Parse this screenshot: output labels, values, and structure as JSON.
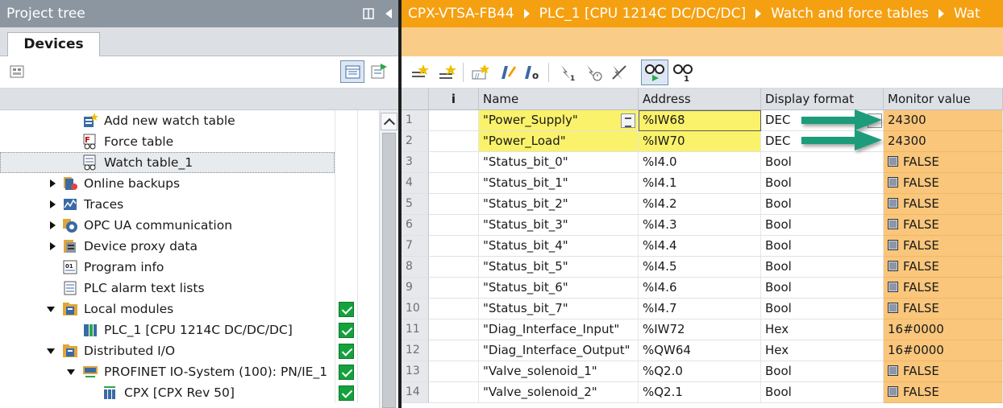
{
  "left_panel": {
    "title": "Project tree",
    "tab_label": "Devices",
    "tree_items": [
      {
        "label": "Add new watch table",
        "icon": "add-watch-table-icon",
        "level": 2,
        "arrow": "none",
        "check": false,
        "selected": false
      },
      {
        "label": "Force table",
        "icon": "force-table-icon",
        "level": 2,
        "arrow": "none",
        "check": false,
        "selected": false
      },
      {
        "label": "Watch table_1",
        "icon": "watch-table-icon",
        "level": 2,
        "arrow": "none",
        "check": false,
        "selected": true
      },
      {
        "label": "Online backups",
        "icon": "online-backups-icon",
        "level": 1,
        "arrow": "right",
        "check": false,
        "selected": false
      },
      {
        "label": "Traces",
        "icon": "traces-icon",
        "level": 1,
        "arrow": "right",
        "check": false,
        "selected": false
      },
      {
        "label": "OPC UA communication",
        "icon": "opc-ua-icon",
        "level": 1,
        "arrow": "right",
        "check": false,
        "selected": false
      },
      {
        "label": "Device proxy data",
        "icon": "device-proxy-icon",
        "level": 1,
        "arrow": "right",
        "check": false,
        "selected": false
      },
      {
        "label": "Program info",
        "icon": "program-info-icon",
        "level": 1,
        "arrow": "none",
        "check": false,
        "selected": false
      },
      {
        "label": "PLC alarm text lists",
        "icon": "alarm-text-icon",
        "level": 1,
        "arrow": "none",
        "check": false,
        "selected": false
      },
      {
        "label": "Local modules",
        "icon": "folder-icon",
        "level": 1,
        "arrow": "down",
        "check": true,
        "selected": false
      },
      {
        "label": "PLC_1 [CPU 1214C DC/DC/DC]",
        "icon": "plc-module-icon",
        "level": 2,
        "arrow": "none",
        "check": true,
        "selected": false
      },
      {
        "label": "Distributed I/O",
        "icon": "folder-icon",
        "level": 1,
        "arrow": "down",
        "check": true,
        "selected": false
      },
      {
        "label": "PROFINET IO-System (100): PN/IE_1",
        "icon": "profinet-system-icon",
        "level": 2,
        "arrow": "down",
        "check": true,
        "selected": false
      },
      {
        "label": "CPX [CPX Rev 50]",
        "icon": "cpx-device-icon",
        "level": 3,
        "arrow": "none",
        "check": true,
        "selected": false
      }
    ]
  },
  "breadcrumb": {
    "items": [
      "CPX-VTSA-FB44",
      "PLC_1 [CPU 1214C DC/DC/DC]",
      "Watch and force tables",
      "Wat"
    ]
  },
  "watch_table": {
    "columns": {
      "info": "i",
      "name": "Name",
      "address": "Address",
      "format": "Display format",
      "monitor": "Monitor value"
    },
    "rows": [
      {
        "num": "1",
        "name": "\"Power_Supply\"",
        "address": "%IW68",
        "format": "DEC",
        "monitor": "24300",
        "bool": false,
        "highlight": true
      },
      {
        "num": "2",
        "name": "\"Power_Load\"",
        "address": "%IW70",
        "format": "DEC",
        "monitor": "24300",
        "bool": false,
        "highlight": true
      },
      {
        "num": "3",
        "name": "\"Status_bit_0\"",
        "address": "%I4.0",
        "format": "Bool",
        "monitor": "FALSE",
        "bool": true,
        "highlight": false
      },
      {
        "num": "4",
        "name": "\"Status_bit_1\"",
        "address": "%I4.1",
        "format": "Bool",
        "monitor": "FALSE",
        "bool": true,
        "highlight": false
      },
      {
        "num": "5",
        "name": "\"Status_bit_2\"",
        "address": "%I4.2",
        "format": "Bool",
        "monitor": "FALSE",
        "bool": true,
        "highlight": false
      },
      {
        "num": "6",
        "name": "\"Status_bit_3\"",
        "address": "%I4.3",
        "format": "Bool",
        "monitor": "FALSE",
        "bool": true,
        "highlight": false
      },
      {
        "num": "7",
        "name": "\"Status_bit_4\"",
        "address": "%I4.4",
        "format": "Bool",
        "monitor": "FALSE",
        "bool": true,
        "highlight": false
      },
      {
        "num": "8",
        "name": "\"Status_bit_5\"",
        "address": "%I4.5",
        "format": "Bool",
        "monitor": "FALSE",
        "bool": true,
        "highlight": false
      },
      {
        "num": "9",
        "name": "\"Status_bit_6\"",
        "address": "%I4.6",
        "format": "Bool",
        "monitor": "FALSE",
        "bool": true,
        "highlight": false
      },
      {
        "num": "10",
        "name": "\"Status_bit_7\"",
        "address": "%I4.7",
        "format": "Bool",
        "monitor": "FALSE",
        "bool": true,
        "highlight": false
      },
      {
        "num": "11",
        "name": "\"Diag_Interface_Input\"",
        "address": "%IW72",
        "format": "Hex",
        "monitor": "16#0000",
        "bool": false,
        "highlight": false
      },
      {
        "num": "12",
        "name": "\"Diag_Interface_Output\"",
        "address": "%QW64",
        "format": "Hex",
        "monitor": "16#0000",
        "bool": false,
        "highlight": false
      },
      {
        "num": "13",
        "name": "\"Valve_solenoid_1\"",
        "address": "%Q2.0",
        "format": "Bool",
        "monitor": "FALSE",
        "bool": true,
        "highlight": false
      },
      {
        "num": "14",
        "name": "\"Valve_solenoid_2\"",
        "address": "%Q2.1",
        "format": "Bool",
        "monitor": "FALSE",
        "bool": true,
        "highlight": false
      }
    ]
  },
  "colors": {
    "titlebar": "#8c96a0",
    "breadcrumb": "#f5a011",
    "monitor_cell": "#f9c67b",
    "highlight": "#faf26a",
    "check": "#14a23c",
    "arrow": "#1a9c7a"
  }
}
